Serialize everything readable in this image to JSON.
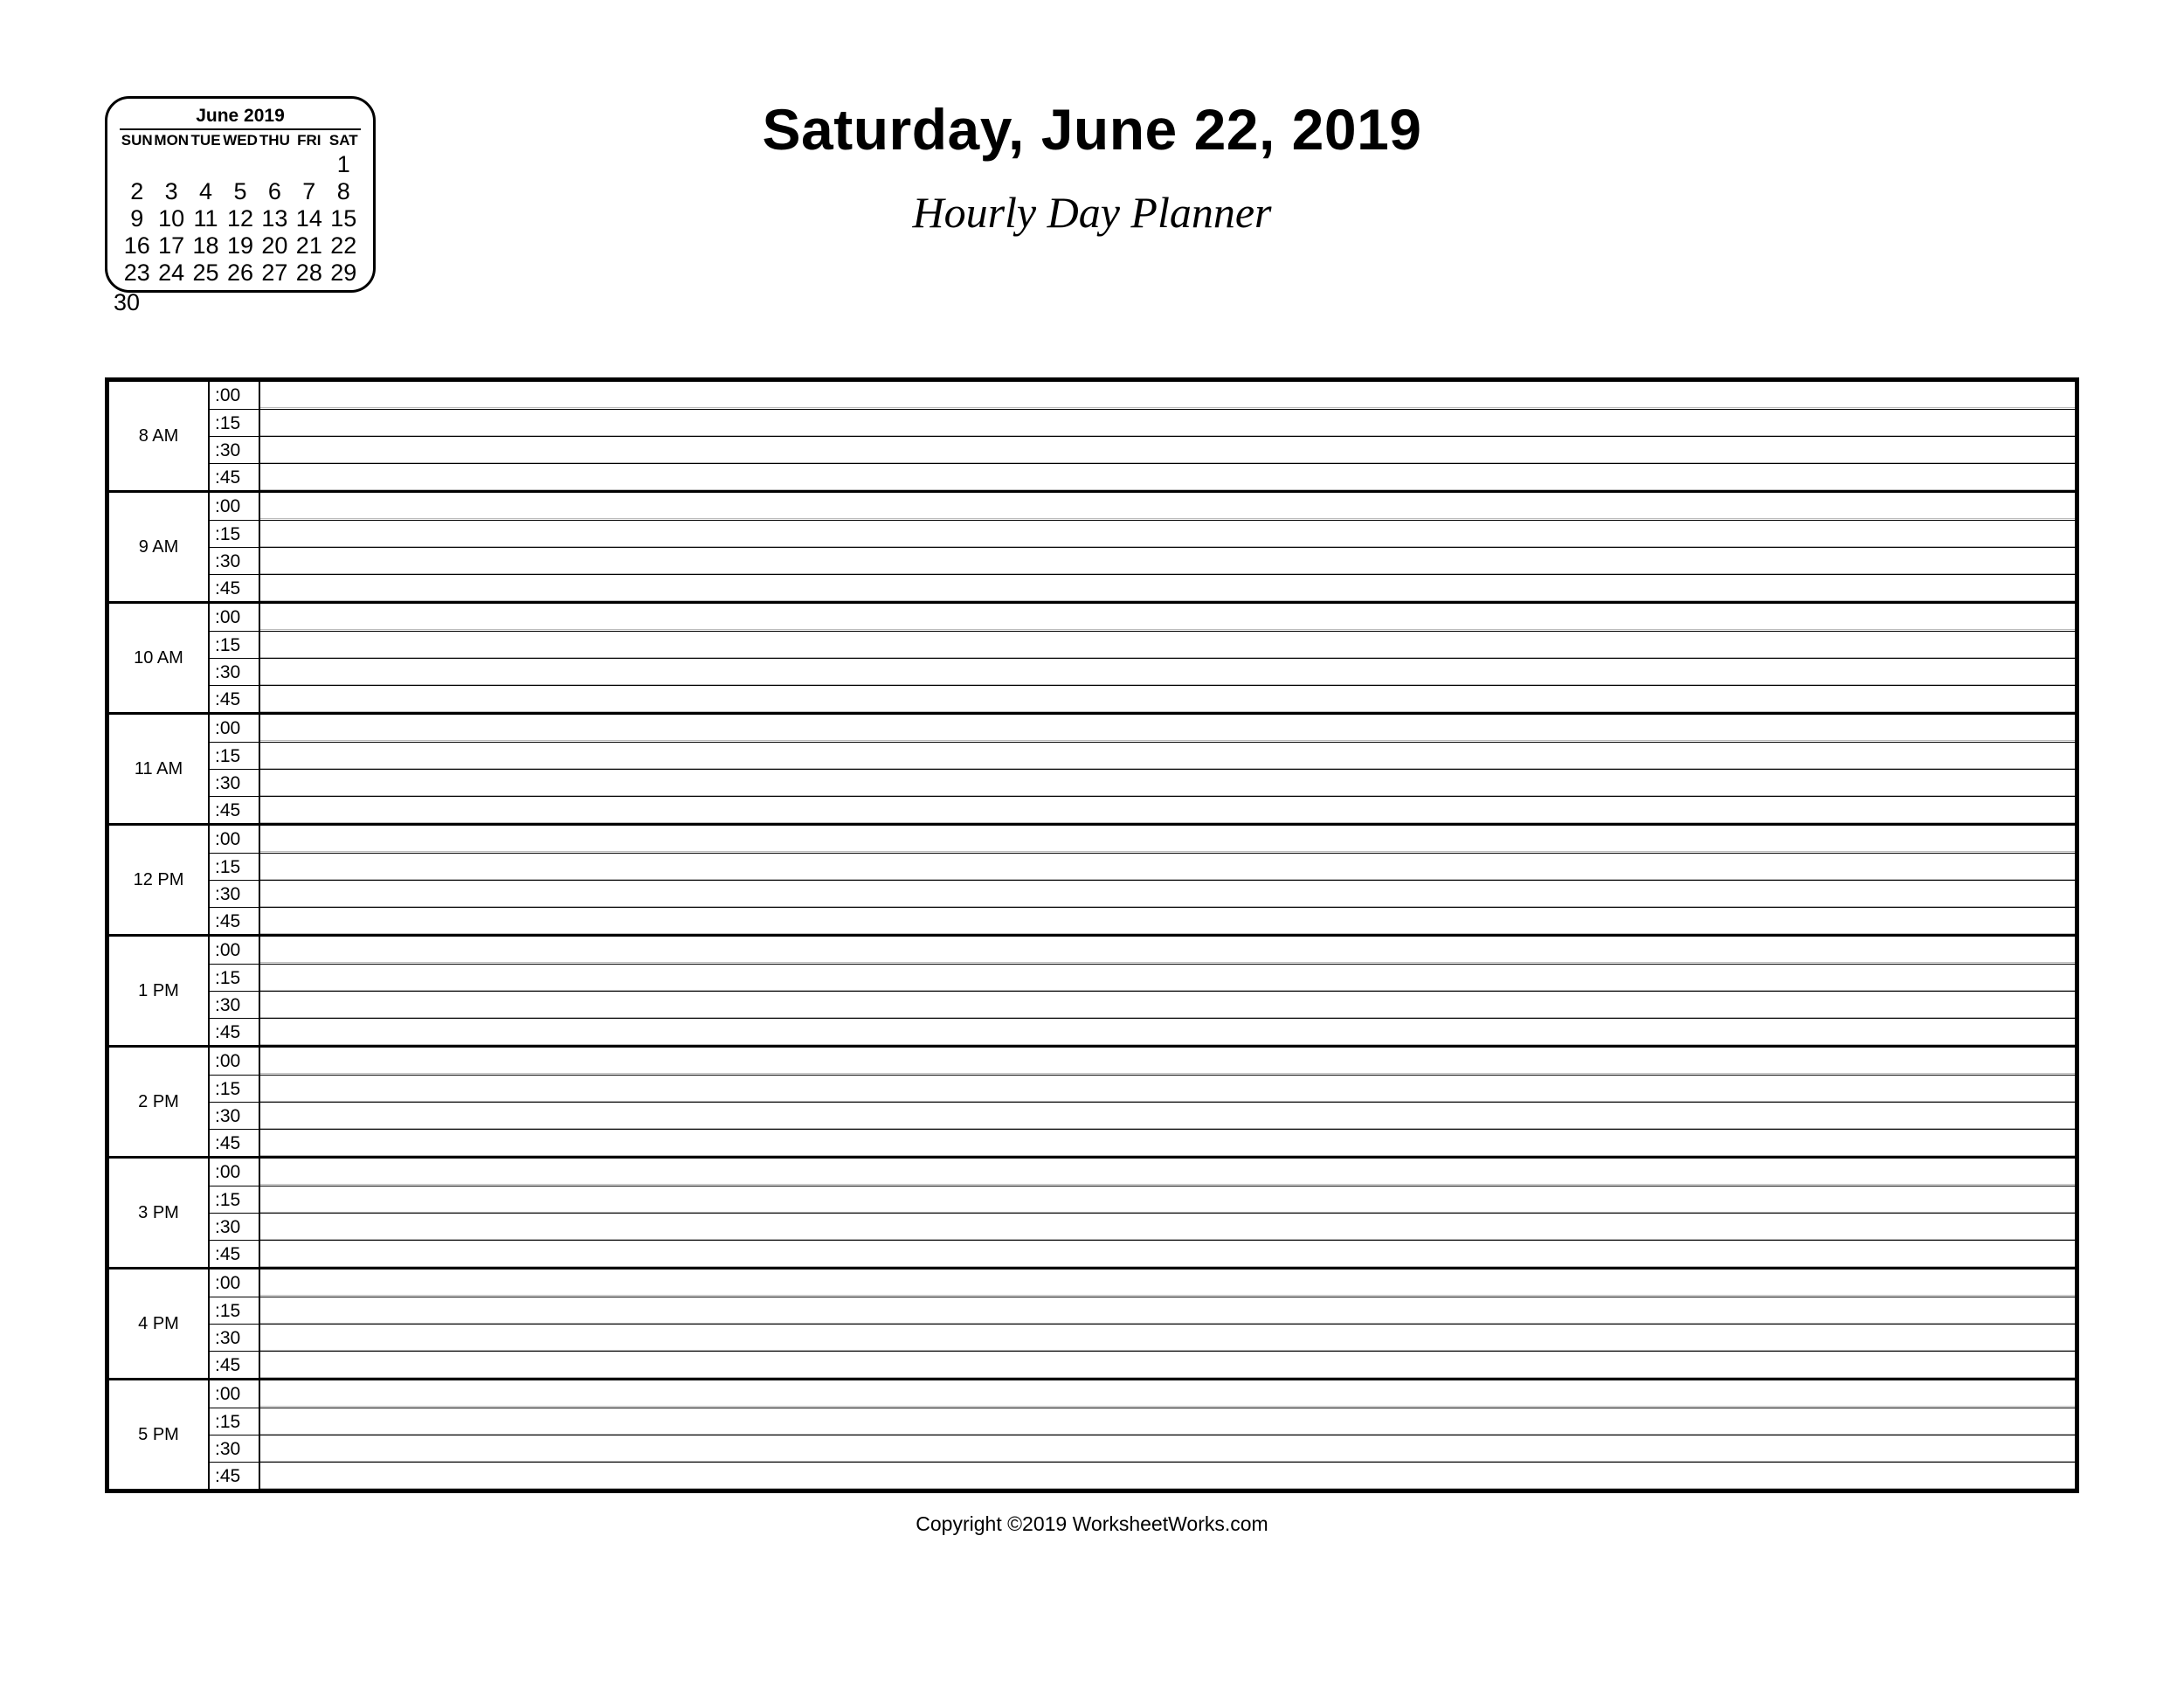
{
  "header": {
    "date_title": "Saturday, June 22, 2019",
    "subtitle": "Hourly Day Planner"
  },
  "mini_calendar": {
    "month_label": "June 2019",
    "day_headers": [
      "SUN",
      "MON",
      "TUE",
      "WED",
      "THU",
      "FRI",
      "SAT"
    ],
    "weeks": [
      [
        "",
        "",
        "",
        "",
        "",
        "",
        "1"
      ],
      [
        "2",
        "3",
        "4",
        "5",
        "6",
        "7",
        "8"
      ],
      [
        "9",
        "10",
        "11",
        "12",
        "13",
        "14",
        "15"
      ],
      [
        "16",
        "17",
        "18",
        "19",
        "20",
        "21",
        "22"
      ],
      [
        "23",
        "24",
        "25",
        "26",
        "27",
        "28",
        "29"
      ]
    ],
    "overflow_day": "30"
  },
  "planner": {
    "quarter_labels": [
      ":00",
      ":15",
      ":30",
      ":45"
    ],
    "hours": [
      {
        "label": "8 AM"
      },
      {
        "label": "9 AM"
      },
      {
        "label": "10 AM"
      },
      {
        "label": "11 AM"
      },
      {
        "label": "12 PM"
      },
      {
        "label": "1 PM"
      },
      {
        "label": "2 PM"
      },
      {
        "label": "3 PM"
      },
      {
        "label": "4 PM"
      },
      {
        "label": "5 PM"
      }
    ]
  },
  "footer": {
    "copyright": "Copyright ©2019 WorksheetWorks.com"
  }
}
